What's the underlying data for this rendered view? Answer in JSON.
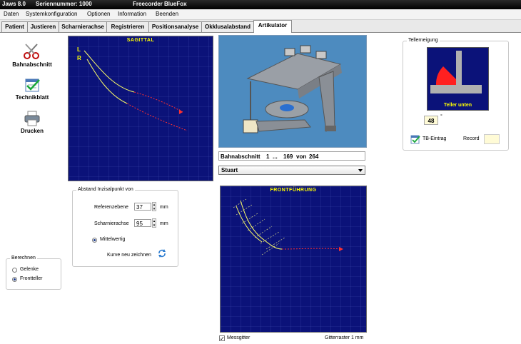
{
  "titlebar": {
    "app": "Jaws 8.0",
    "serial": "Seriennummer: 1000",
    "recorder": "Freecorder BlueFox"
  },
  "menu": [
    "Daten",
    "Systemkonfiguration",
    "Optionen",
    "Information",
    "Beenden"
  ],
  "tabs": [
    "Patient",
    "Justieren",
    "Scharnierachse",
    "Registrieren",
    "Positionsanalyse",
    "Okklusalabstand",
    "Artikulator"
  ],
  "active_tab": "Artikulator",
  "tools": {
    "bahnabschnitt": "Bahnabschnitt",
    "technikblatt": "Technikblatt",
    "drucken": "Drucken"
  },
  "icons": {
    "scissors": "scissors-icon",
    "checklist": "checklist-icon",
    "printer": "printer-icon",
    "refresh": "refresh-icon"
  },
  "sagittal": {
    "title": "SAGITTAL",
    "label_l": "L",
    "label_r": "R"
  },
  "abstand": {
    "legend": "Abstand Inzisalpunkt von",
    "ref_label": "Referenzebene",
    "ref_value": "37",
    "ref_unit": "mm",
    "scharnier_label": "Scharnierachse",
    "scharnier_value": "95",
    "scharnier_unit": "mm",
    "mittelwertig": "Mittelwertig",
    "kurve": "Kurve neu zeichnen"
  },
  "berechnen": {
    "legend": "Berechnen",
    "opt1": "Gelenke",
    "opt2": "Frontteller",
    "selected": "Frontteller"
  },
  "info": {
    "bahn_label": "Bahnabschnitt",
    "bahn_start": "1",
    "bahn_sep": "...",
    "bahn_current": "169",
    "bahn_von": "von",
    "bahn_total": "264"
  },
  "articulator_select": "Stuart",
  "front": {
    "title": "FRONTFÜHRUNG",
    "messgitter": "Messgitter",
    "gitterraster": "Gitterraster 1 mm"
  },
  "teller": {
    "legend": "Tellerneigung",
    "caption": "Teller unten",
    "value": "48",
    "unit": "°",
    "tb_eintrag": "TB-Eintrag",
    "record": "Record"
  },
  "colors": {
    "plot_bg": "#0b1279",
    "grid": "#3a44a8",
    "path_yellow": "#ffff66",
    "path_red": "#ff3030",
    "teller_red": "#ff2020"
  }
}
